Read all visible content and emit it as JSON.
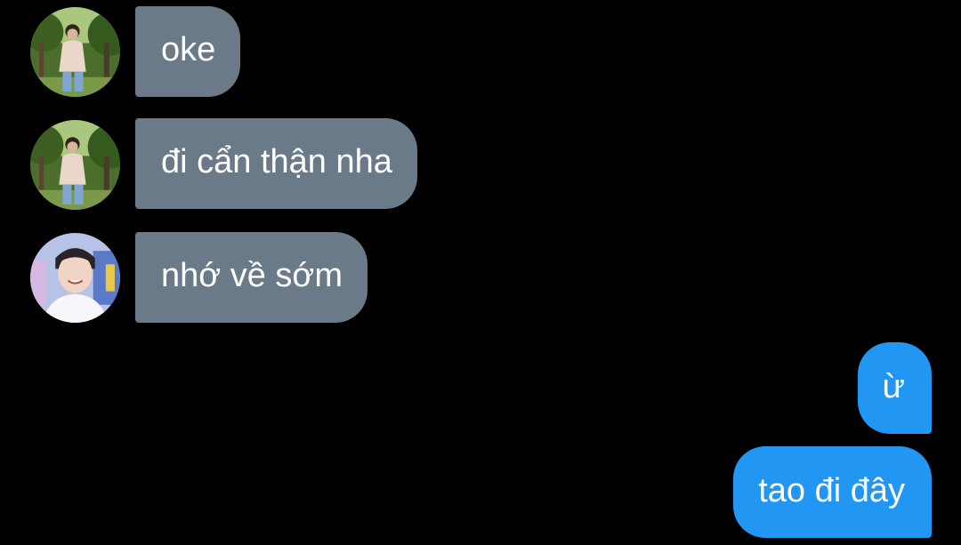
{
  "colors": {
    "background": "#000000",
    "incoming_bubble": "#6b7a88",
    "outgoing_bubble": "#2196f3",
    "bubble_text": "#ffffff"
  },
  "messages": [
    {
      "direction": "incoming",
      "text": "oke",
      "avatar": "avatar-photo-park"
    },
    {
      "direction": "incoming",
      "text": "đi cẩn thận nha",
      "avatar": "avatar-photo-park"
    },
    {
      "direction": "incoming",
      "text": "nhớ về sớm",
      "avatar": "avatar-photo-smiling"
    },
    {
      "direction": "outgoing",
      "text": "ừ"
    },
    {
      "direction": "outgoing",
      "text": "tao đi đây"
    }
  ]
}
